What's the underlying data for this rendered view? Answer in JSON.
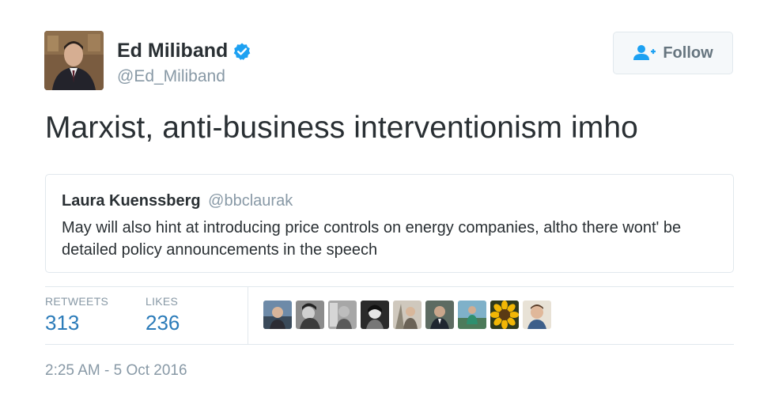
{
  "author": {
    "name": "Ed Miliband",
    "handle": "@Ed_Miliband",
    "verified": true
  },
  "follow_button": {
    "label": "Follow",
    "icon": "follow-person-plus-icon"
  },
  "tweet_text": "Marxist, anti-business interventionism imho",
  "quoted_tweet": {
    "name": "Laura Kuenssberg",
    "handle": "@bbclaurak",
    "text": "May will also hint at introducing price controls on energy companies, altho there wont' be detailed policy announcements in the speech"
  },
  "stats": {
    "retweets_label": "RETWEETS",
    "retweets_value": "313",
    "likes_label": "LIKES",
    "likes_value": "236"
  },
  "likers_count_shown": 9,
  "timestamp": "2:25 AM - 5 Oct 2016",
  "colors": {
    "link_blue": "#2b7bb9",
    "muted_gray": "#8899a6",
    "verified_blue": "#1da1f2",
    "border": "#e1e8ed"
  }
}
